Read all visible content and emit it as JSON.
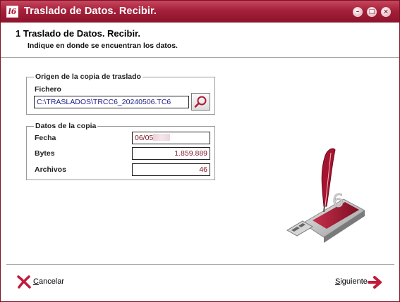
{
  "window": {
    "title": "Traslado de Datos. Recibir.",
    "app_icon_glyph": "l6",
    "controls": [
      "minimize",
      "maximize",
      "close"
    ]
  },
  "header": {
    "step_title": "1  Traslado de Datos. Recibir.",
    "step_subtitle": "Indique en donde se encuentran los datos."
  },
  "origin": {
    "legend": "Origen de la copia de traslado",
    "file_label": "Fichero",
    "file_value": "C:\\TRASLADOS\\TRCC6_20240506.TC6",
    "browse_icon": "search-icon"
  },
  "copy_data": {
    "legend": "Datos de la copia",
    "date_label": "Fecha",
    "date_value": "06/05",
    "bytes_label": "Bytes",
    "bytes_value": "1.859.889",
    "files_label": "Archivos",
    "files_value": "46"
  },
  "footer": {
    "cancel_first": "C",
    "cancel_rest": "ancelar",
    "next_first": "S",
    "next_rest": "iguiente"
  },
  "colors": {
    "accent": "#a5203a",
    "value_text": "#7b1425"
  }
}
